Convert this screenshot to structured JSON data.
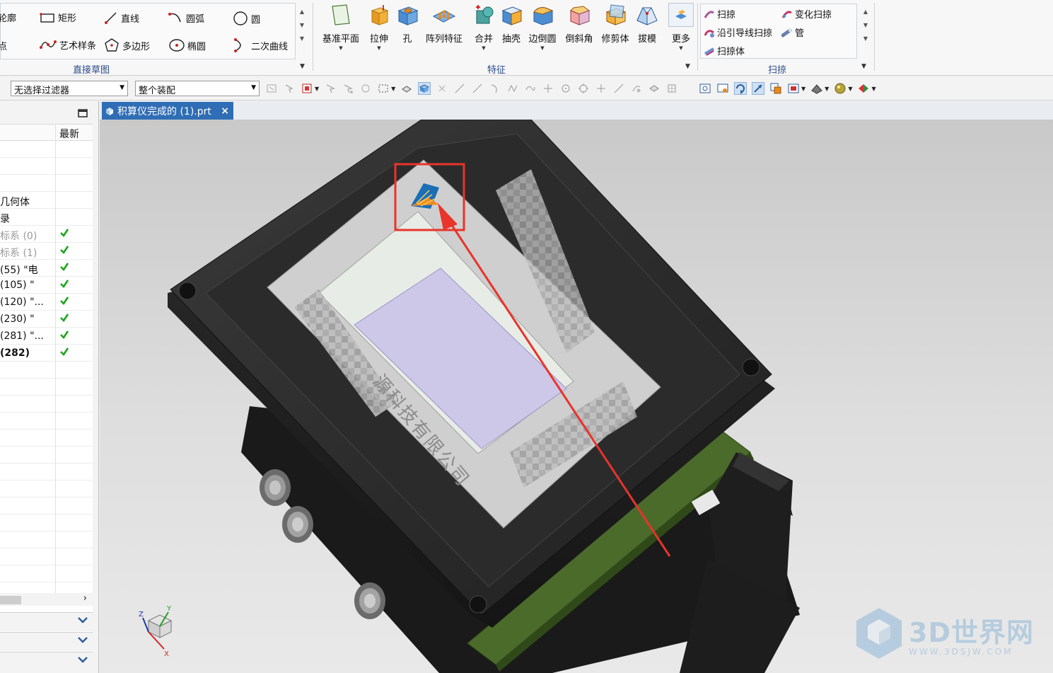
{
  "ribbon": {
    "sketch_group": {
      "label": "直接草图",
      "items": {
        "contour": "轮廓",
        "rect": "矩形",
        "line": "直线",
        "arc": "圆弧",
        "circle": "圆",
        "point": "点",
        "studio_spline": "艺术样条",
        "polygon": "多边形",
        "ellipse": "椭圆",
        "conic": "二次曲线"
      }
    },
    "feature_group": {
      "label": "特征",
      "buttons": {
        "datum_plane": "基准平面",
        "extrude": "拉伸",
        "hole": "孔",
        "pattern": "阵列特征",
        "unite": "合并",
        "shell": "抽壳",
        "edge_blend": "边倒圆",
        "chamfer": "倒斜角",
        "trim_body": "修剪体",
        "draft": "拔模",
        "more": "更多"
      }
    },
    "sweep_group": {
      "label": "扫掠",
      "items": {
        "swept": "扫掠",
        "variational_sweep": "变化扫掠",
        "sweep_along_guide": "沿引导线扫掠",
        "tube": "管",
        "swept_volume": "扫掠体"
      }
    }
  },
  "toolbar": {
    "filter_value": "无选择过滤器",
    "scope_value": "整个装配"
  },
  "navigator": {
    "column_latest": "最新",
    "rows": [
      {
        "text": "",
        "style": "",
        "check": false
      },
      {
        "text": "",
        "style": "",
        "check": false
      },
      {
        "text": "",
        "style": "",
        "check": false
      },
      {
        "text": "几何体",
        "style": "",
        "check": false
      },
      {
        "text": "录",
        "style": "",
        "check": false
      },
      {
        "text": "标系 (0)",
        "style": "gray",
        "check": true
      },
      {
        "text": "标系 (1)",
        "style": "gray",
        "check": true
      },
      {
        "text": "(55) \"电",
        "style": "",
        "check": true
      },
      {
        "text": "(105) \"",
        "style": "",
        "check": true
      },
      {
        "text": "(120) \"...",
        "style": "",
        "check": true
      },
      {
        "text": "(230) \"",
        "style": "",
        "check": true
      },
      {
        "text": "(281) \"...",
        "style": "",
        "check": true
      },
      {
        "text": "(282)",
        "style": "bold",
        "check": true
      }
    ],
    "check_color": "#1aa51a"
  },
  "graphics": {
    "tab_title": "积算仪完成的 (1).prt",
    "tab_close": "×",
    "label_company": "源科技有限公司",
    "annotation_color": "#e8342a",
    "triad": {
      "x": "X",
      "y": "Y",
      "z": "Z"
    }
  },
  "watermark": {
    "title": "3D世界网",
    "url": "WWW.3DSJW.COM"
  }
}
